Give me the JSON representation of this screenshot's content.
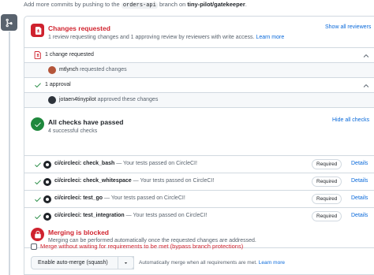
{
  "header": {
    "prefix": "Add more commits by pushing to the",
    "branch": "orders-api",
    "middle": "branch on",
    "repo": "tiny-pilot/gatekeeper",
    "suffix": "."
  },
  "changes_requested": {
    "title": "Changes requested",
    "subtitle": "1 review requesting changes and 1 approving review by reviewers with write access.",
    "learn_more": "Learn more",
    "show_all": "Show all reviewers"
  },
  "change_group": {
    "label": "1 change requested",
    "reviewer": "mtlynch",
    "action": "requested changes"
  },
  "approval_group": {
    "label": "1 approval",
    "reviewer": "jotaen4tinypilot",
    "action": "approved these changes"
  },
  "checks": {
    "title": "All checks have passed",
    "subtitle": "4 successful checks",
    "hide_all": "Hide all checks",
    "required_label": "Required",
    "details_label": "Details",
    "items": [
      {
        "name": "ci/circleci: check_bash",
        "desc": "— Your tests passed on CircleCI!"
      },
      {
        "name": "ci/circleci: check_whitespace",
        "desc": "— Your tests passed on CircleCI!"
      },
      {
        "name": "ci/circleci: test_go",
        "desc": "— Your tests passed on CircleCI!"
      },
      {
        "name": "ci/circleci: test_integration",
        "desc": "— Your tests passed on CircleCI!"
      }
    ]
  },
  "merge_block": {
    "title": "Merging is blocked",
    "subtitle": "Merging can be performed automatically once the requested changes are addressed."
  },
  "bypass": {
    "label": "Merge without waiting for requirements to be met (bypass branch protections)",
    "checked": false
  },
  "auto_merge": {
    "button_label": "Enable auto-merge (squash)",
    "note": "Automatically merge when all requirements are met.",
    "learn_more": "Learn more"
  },
  "colors": {
    "red": "#cf222e",
    "green": "#1f883d",
    "link": "#0969da",
    "border": "#d1d9e0"
  },
  "icons": [
    "git-merge-icon",
    "file-diff-icon",
    "check-icon",
    "chevron-up-icon",
    "circleci-icon",
    "chevron-down-icon"
  ]
}
